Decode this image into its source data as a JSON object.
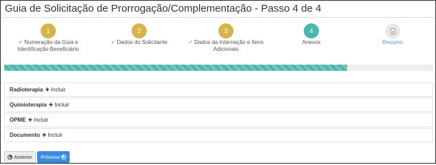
{
  "header": {
    "title": "Guia de Solicitação de Prorrogação/Complementação - Passo 4 de 4"
  },
  "stepper": {
    "steps": [
      {
        "number": "1",
        "label_line1": "Numeração da Guia e",
        "label_line2": "Identificação Beneficiário",
        "status": "done"
      },
      {
        "number": "2",
        "label_line1": "Dados do Solicitante",
        "label_line2": "",
        "status": "done"
      },
      {
        "number": "3",
        "label_line1": "Dados da Internação e Itens",
        "label_line2": "Adicionais",
        "status": "done"
      },
      {
        "number": "4",
        "label_line1": "Anexos",
        "label_line2": "",
        "status": "current"
      },
      {
        "number": "",
        "label_line1": "Resumo",
        "label_line2": "",
        "status": "todo",
        "icon": "document-icon"
      }
    ],
    "done_color": "#d6b44b",
    "current_color": "#4db6ac",
    "todo_color": "#e8e8e8",
    "check_icon": "check-icon"
  },
  "progress": {
    "fraction": 0.8,
    "color": "#4db6ac"
  },
  "sections": [
    {
      "title": "Radioterapia",
      "action": "Incluir"
    },
    {
      "title": "Quimioterapia",
      "action": "Incluir"
    },
    {
      "title": "OPME",
      "action": "Incluir"
    },
    {
      "title": "Documento",
      "action": "Incluir"
    }
  ],
  "footer": {
    "prev_label": "Anterior",
    "next_label": "Próximo",
    "next_color": "#3c8dde"
  }
}
